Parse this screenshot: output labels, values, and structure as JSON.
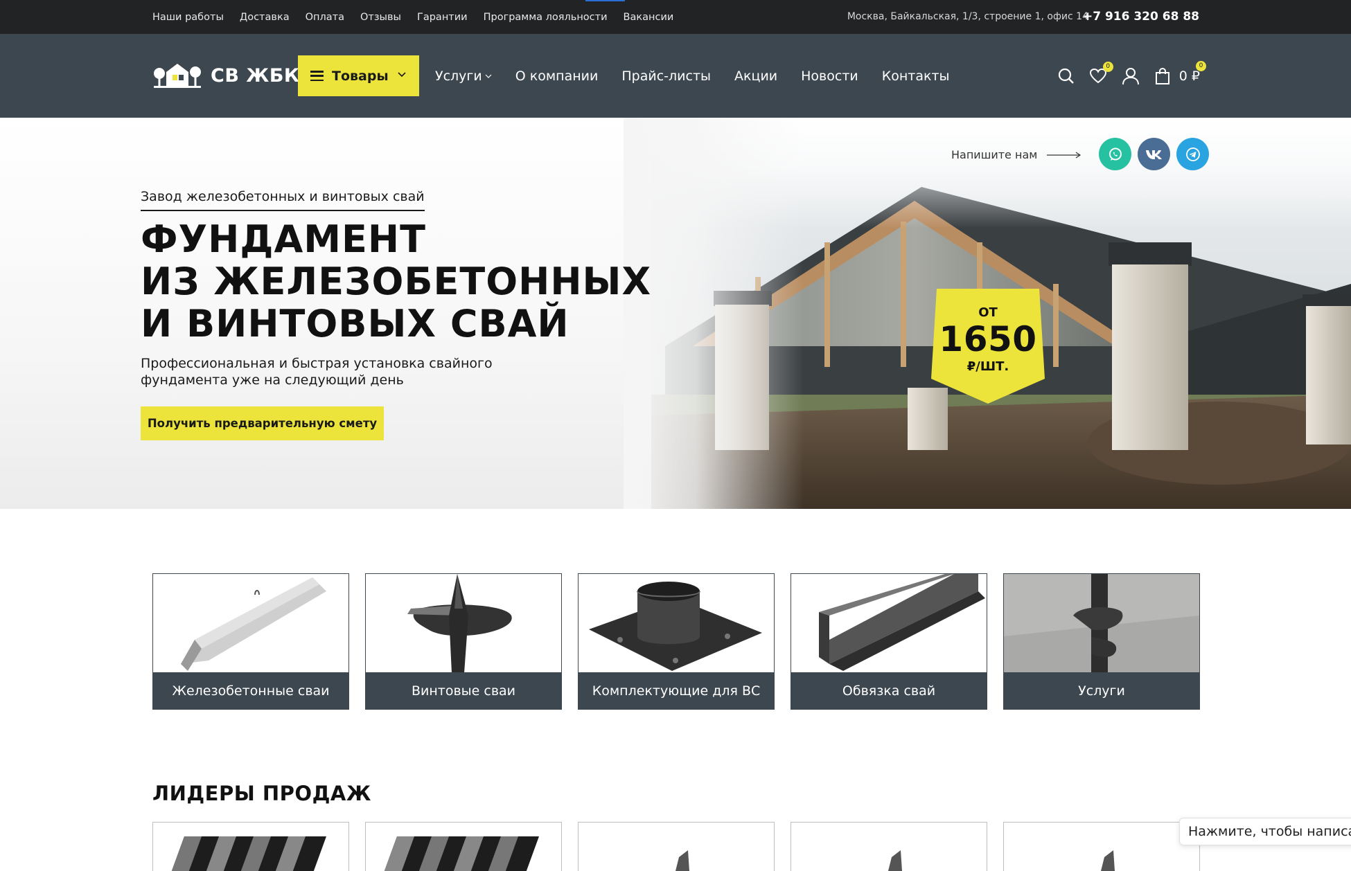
{
  "topbar": {
    "links": [
      "Наши работы",
      "Доставка",
      "Оплата",
      "Отзывы",
      "Гарантии",
      "Программа лояльности",
      "Вакансии"
    ],
    "address": "Москва, Байкальская, 1/3, строение 1, офис 14",
    "phone": "+7 916 320 68 88"
  },
  "header": {
    "logo_text": "СВ ЖБК",
    "goods_label": "Товары",
    "nav": [
      "Услуги",
      "О компании",
      "Прайс-листы",
      "Акции",
      "Новости",
      "Контакты"
    ],
    "wishlist_count": "0",
    "cart_count": "0",
    "cart_total": "0 ₽"
  },
  "hero": {
    "subtitle": "Завод железобетонных и винтовых свай",
    "title_lines": [
      "ФУНДАМЕНТ",
      "ИЗ ЖЕЛЕЗОБЕТОННЫХ",
      "И ВИНТОВЫХ СВАЙ"
    ],
    "lead": "Профессиональная и быстрая установка свайного фундамента уже на следующий день",
    "cta": "Получить предварительную смету",
    "write_us": "Напишите нам",
    "price_badge": {
      "from": "ОТ",
      "value": "1650",
      "unit": "₽/ШТ."
    }
  },
  "categories": [
    {
      "label": "Железобетонные сваи",
      "icon": "concrete-pile"
    },
    {
      "label": "Винтовые сваи",
      "icon": "screw-pile"
    },
    {
      "label": "Комплектующие для ВС",
      "icon": "pile-head-plate"
    },
    {
      "label": "Обвязка свай",
      "icon": "channel-beam"
    },
    {
      "label": "Услуги",
      "icon": "screw-in-ground"
    }
  ],
  "bestsellers_title": "ЛИДЕРЫ ПРОДАЖ",
  "chat_popup": "Нажмите, чтобы написать",
  "colors": {
    "accent": "#ece43b",
    "header_bg": "#3d4750",
    "topbar_bg": "#222325",
    "whatsapp": "#25c1a0",
    "vk": "#4a6d95",
    "telegram": "#2aa4e0"
  }
}
